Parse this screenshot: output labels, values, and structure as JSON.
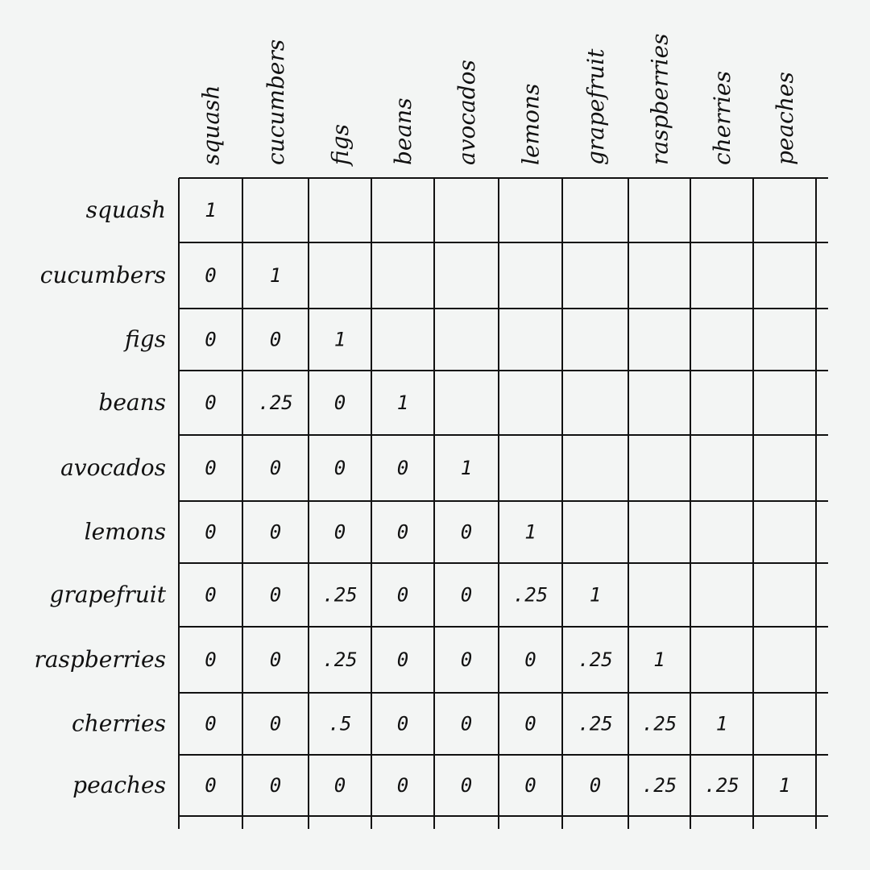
{
  "chart_data": {
    "type": "table",
    "title": "",
    "subtitle": "",
    "description": "Lower-triangular correlation-style matrix of produce items",
    "row_labels": [
      "squash",
      "cucumbers",
      "figs",
      "beans",
      "avocados",
      "lemons",
      "grapefruit",
      "raspberries",
      "cherries",
      "peaches"
    ],
    "column_labels": [
      "squash",
      "cucumbers",
      "figs",
      "beans",
      "avocados",
      "lemons",
      "grapefruit",
      "raspberries",
      "cherries",
      "peaches"
    ],
    "cells": [
      [
        "1"
      ],
      [
        "0",
        "1"
      ],
      [
        "0",
        "0",
        "1"
      ],
      [
        "0",
        ".25",
        "0",
        "1"
      ],
      [
        "0",
        "0",
        "0",
        "0",
        "1"
      ],
      [
        "0",
        "0",
        "0",
        "0",
        "0",
        "1"
      ],
      [
        "0",
        "0",
        ".25",
        "0",
        "0",
        ".25",
        "1"
      ],
      [
        "0",
        "0",
        ".25",
        "0",
        "0",
        "0",
        ".25",
        "1"
      ],
      [
        "0",
        "0",
        ".5",
        "0",
        "0",
        "0",
        ".25",
        ".25",
        "1"
      ],
      [
        "0",
        "0",
        "0",
        "0",
        "0",
        "0",
        "0",
        ".25",
        ".25",
        "1"
      ]
    ],
    "values": [
      [
        1
      ],
      [
        0,
        1
      ],
      [
        0,
        0,
        1
      ],
      [
        0,
        0.25,
        0,
        1
      ],
      [
        0,
        0,
        0,
        0,
        1
      ],
      [
        0,
        0,
        0,
        0,
        0,
        1
      ],
      [
        0,
        0,
        0.25,
        0,
        0,
        0.25,
        1
      ],
      [
        0,
        0,
        0.25,
        0,
        0,
        0,
        0.25,
        1
      ],
      [
        0,
        0,
        0.5,
        0,
        0,
        0,
        0.25,
        0.25,
        1
      ],
      [
        0,
        0,
        0,
        0,
        0,
        0,
        0,
        0.25,
        0.25,
        1
      ]
    ],
    "upper_triangle": "blank",
    "grid": true
  }
}
